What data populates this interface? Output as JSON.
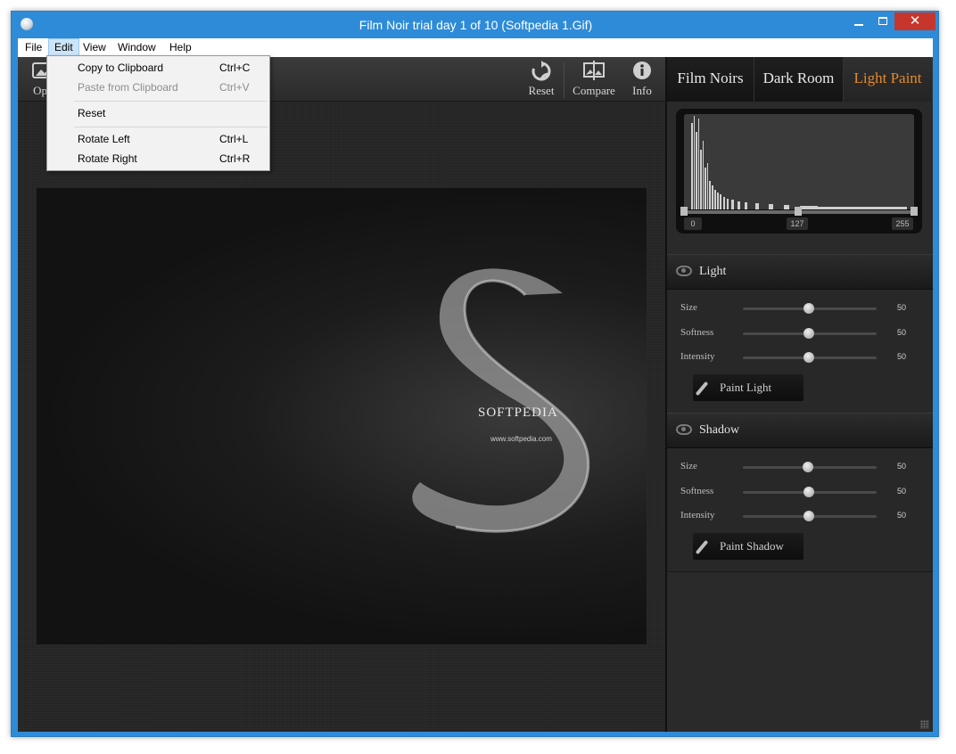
{
  "window": {
    "title": "Film Noir trial day 1 of 10 (Softpedia 1.Gif)",
    "close_label": "✕"
  },
  "menubar": {
    "items": [
      "File",
      "Edit",
      "View",
      "Window",
      "Help"
    ]
  },
  "edit_menu": {
    "copy": {
      "label": "Copy to Clipboard",
      "shortcut": "Ctrl+C"
    },
    "paste": {
      "label": "Paste from Clipboard",
      "shortcut": "Ctrl+V"
    },
    "reset": {
      "label": "Reset"
    },
    "rotate_left": {
      "label": "Rotate Left",
      "shortcut": "Ctrl+L"
    },
    "rotate_right": {
      "label": "Rotate Right",
      "shortcut": "Ctrl+R"
    }
  },
  "toolbar": {
    "open_label": "Ope",
    "reset_label": "Reset",
    "compare_label": "Compare",
    "info_label": "Info"
  },
  "image": {
    "brand": "SOFTPEDIA",
    "url": "www.softpedia.com"
  },
  "tabs": [
    "Film Noirs",
    "Dark Room",
    "Light Paint"
  ],
  "histogram": {
    "min_label": "0",
    "mid_label": "127",
    "max_label": "255"
  },
  "light": {
    "title": "Light",
    "size_label": "Size",
    "size_value": "50",
    "softness_label": "Softness",
    "softness_value": "50",
    "intensity_label": "Intensity",
    "intensity_value": "50",
    "button_label": "Paint Light"
  },
  "shadow": {
    "title": "Shadow",
    "size_label": "Size",
    "size_value": "50",
    "softness_label": "Softness",
    "softness_value": "50",
    "intensity_label": "Intensity",
    "intensity_value": "50",
    "button_label": "Paint Shadow"
  },
  "colors": {
    "accent": "#e38a2a",
    "titlebar": "#2e8bd8",
    "close_button": "#c7362c"
  }
}
